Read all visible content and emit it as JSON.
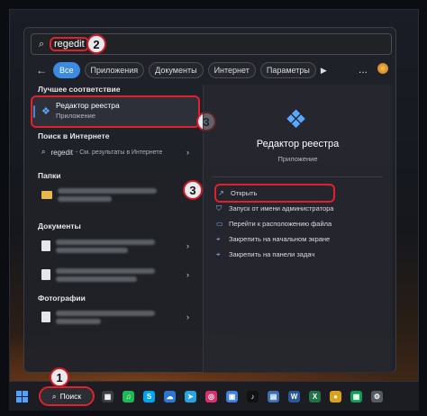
{
  "search": {
    "icon": "search-icon",
    "query": "regedit"
  },
  "filters": {
    "back": "←",
    "items": [
      {
        "label": "Все",
        "active": true
      },
      {
        "label": "Приложения",
        "active": false
      },
      {
        "label": "Документы",
        "active": false
      },
      {
        "label": "Интернет",
        "active": false
      },
      {
        "label": "Параметры",
        "active": false
      }
    ],
    "play": "▶",
    "more": "..."
  },
  "left": {
    "best_match": {
      "header": "Лучшее соответствие",
      "title": "Редактор реестра",
      "subtitle": "Приложение"
    },
    "web": {
      "header": "Поиск в Интернете",
      "query": "regedit",
      "suffix": "- См. результаты в Интернете"
    },
    "folders": {
      "header": "Папки"
    },
    "documents": {
      "header": "Документы"
    },
    "photos": {
      "header": "Фотографии"
    }
  },
  "right": {
    "title": "Редактор реестра",
    "subtitle": "Приложение",
    "actions": [
      {
        "icon": "open-icon",
        "label": "Открыть"
      },
      {
        "icon": "shield-icon",
        "label": "Запуск от имени администратора"
      },
      {
        "icon": "folder-icon",
        "label": "Перейти к расположению файла"
      },
      {
        "icon": "pin-icon",
        "label": "Закрепить на начальном экране"
      },
      {
        "icon": "pin-icon",
        "label": "Закрепить на панели задач"
      }
    ]
  },
  "taskbar": {
    "search_label": "Поиск",
    "badge_count": "10",
    "apps": [
      {
        "name": "calculator",
        "color": "#3a3d44",
        "glyph": "▦"
      },
      {
        "name": "spotify",
        "color": "#1db954",
        "glyph": "♫"
      },
      {
        "name": "skype",
        "color": "#00a4ef",
        "glyph": "S"
      },
      {
        "name": "onedrive",
        "color": "#2b78d4",
        "glyph": "☁"
      },
      {
        "name": "telegram",
        "color": "#27a3e3",
        "glyph": "➤"
      },
      {
        "name": "instagram",
        "color": "#d6306e",
        "glyph": "◎"
      },
      {
        "name": "photos",
        "color": "#3f7fe0",
        "glyph": "▣"
      },
      {
        "name": "tiktok",
        "color": "#111",
        "glyph": "♪"
      },
      {
        "name": "explorer",
        "color": "#3d6fb3",
        "glyph": "▤"
      },
      {
        "name": "word",
        "color": "#2b579a",
        "glyph": "W"
      },
      {
        "name": "excel",
        "color": "#217346",
        "glyph": "X"
      },
      {
        "name": "chrome",
        "color": "#d9a21a",
        "glyph": "●"
      },
      {
        "name": "sheets",
        "color": "#0f9d58",
        "glyph": "▦"
      },
      {
        "name": "settings",
        "color": "#555a63",
        "glyph": "⚙"
      }
    ]
  },
  "annotations": {
    "badge1": "1",
    "badge2": "2",
    "badge3a": "3",
    "badge3b": "3",
    "highlight_color": "#e0202a"
  }
}
